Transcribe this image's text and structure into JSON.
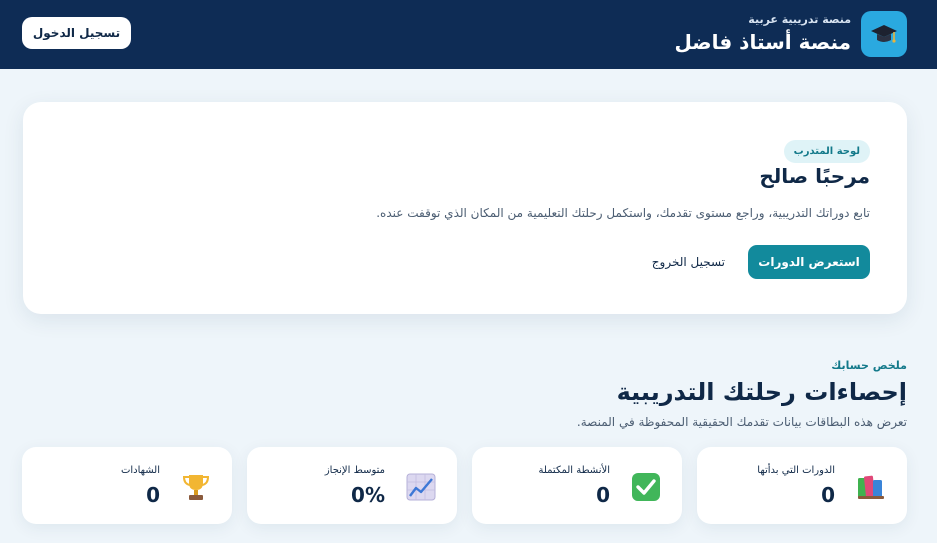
{
  "header": {
    "brand_subtitle": "منصة تدريبية عربية",
    "brand_title": "منصة أستاذ فاضل",
    "logo_icon": "graduation-cap-icon",
    "login_label": "تسجيل الدخول"
  },
  "welcome": {
    "badge": "لوحة المتدرب",
    "title": "مرحبًا صالح",
    "description": "تابع دوراتك التدريبية، وراجع مستوى تقدمك، واستكمل رحلتك التعليمية من المكان الذي توقفت عنده.",
    "browse_label": "استعرض الدورات",
    "logout_label": "تسجيل الخروج"
  },
  "summary": {
    "kicker": "ملخص حسابك",
    "title": "إحصاءات رحلتك التدريبية",
    "description": "تعرض هذه البطاقات بيانات تقدمك الحقيقية المحفوظة في المنصة.",
    "stats": [
      {
        "label": "الدورات التي بدأتها",
        "value": "0",
        "icon": "books-icon"
      },
      {
        "label": "الأنشطة المكتملة",
        "value": "0",
        "icon": "check-mark-icon"
      },
      {
        "label": "متوسط الإنجاز",
        "value": "0%",
        "icon": "chart-increasing-icon"
      },
      {
        "label": "الشهادات",
        "value": "0",
        "icon": "trophy-icon"
      }
    ]
  },
  "colors": {
    "header_bg": "#0e2c55",
    "accent": "#128a9c",
    "logo_bg": "#2aa9e0",
    "page_bg": "#eef5fa"
  }
}
